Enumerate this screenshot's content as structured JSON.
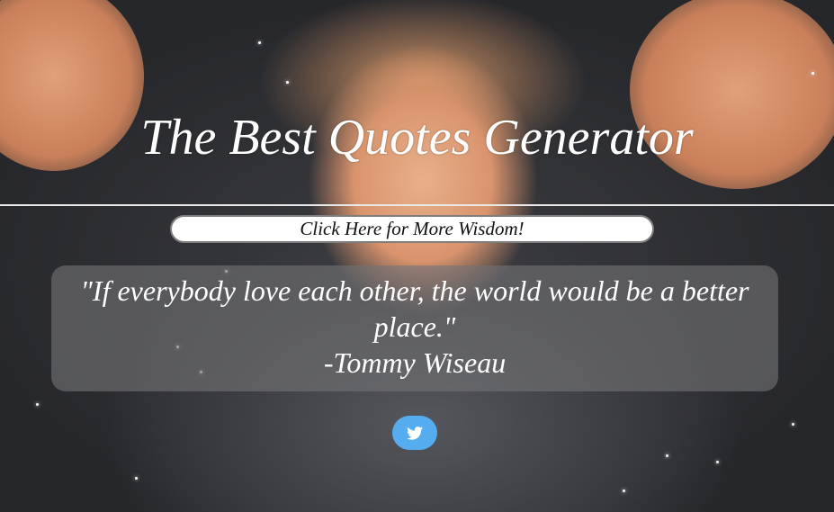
{
  "page": {
    "title": "The Best Quotes Generator"
  },
  "actions": {
    "more_label": "Click Here for More Wisdom!"
  },
  "quote": {
    "text": "\"If everybody love each other, the world would be a better place.\"",
    "author": "-Tommy Wiseau"
  },
  "share": {
    "icon": "twitter-icon",
    "color": "#55acee"
  },
  "theme": {
    "text_color": "#ffffff",
    "quote_box_color": "rgba(115,115,118,0.62)"
  }
}
